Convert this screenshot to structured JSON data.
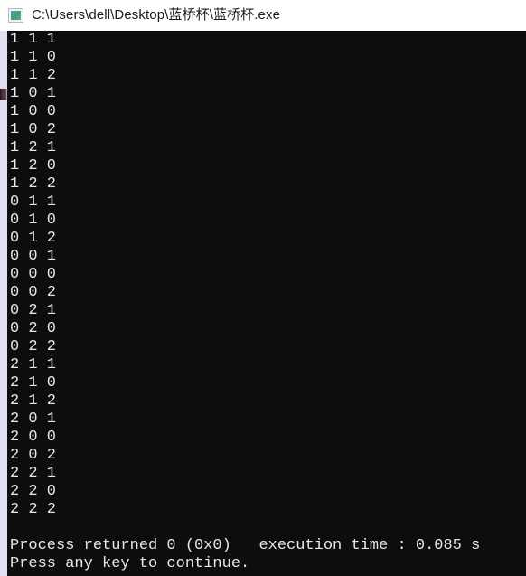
{
  "window": {
    "title": "C:\\Users\\dell\\Desktop\\蓝桥杯\\蓝桥杯.exe",
    "icon": "console-app-icon",
    "background_color": "#0d0d0d",
    "titlebar_color": "#ffffff",
    "text_color": "#e8e8e8"
  },
  "console": {
    "output_lines": [
      "1 1 1",
      "1 1 0",
      "1 1 2",
      "1 0 1",
      "1 0 0",
      "1 0 2",
      "1 2 1",
      "1 2 0",
      "1 2 2",
      "0 1 1",
      "0 1 0",
      "0 1 2",
      "0 0 1",
      "0 0 0",
      "0 0 2",
      "0 2 1",
      "0 2 0",
      "0 2 2",
      "2 1 1",
      "2 1 0",
      "2 1 2",
      "2 0 1",
      "2 0 0",
      "2 0 2",
      "2 2 1",
      "2 2 0",
      "2 2 2"
    ],
    "blank_line": "",
    "status_lines": [
      "Process returned 0 (0x0)   execution time : 0.085 s",
      "Press any key to continue."
    ],
    "exit_code": "0",
    "exit_code_hex": "0x0",
    "execution_time": "0.085 s"
  }
}
